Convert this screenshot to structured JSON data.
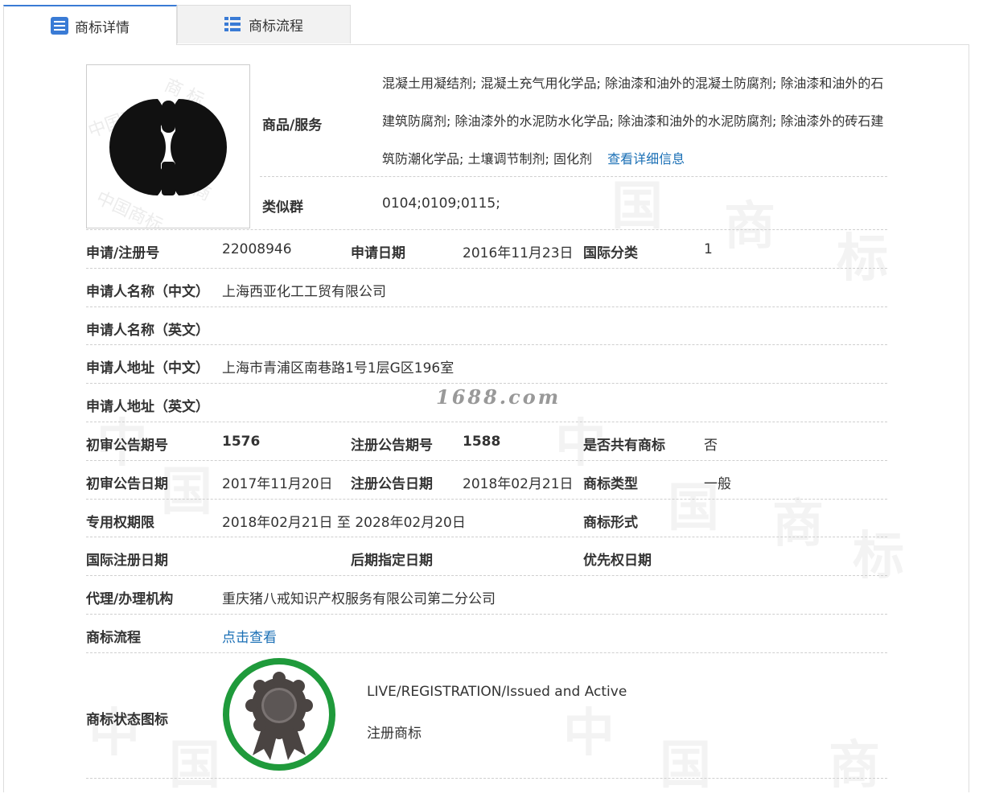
{
  "tabs": [
    {
      "label": "商标详情",
      "icon": "list-document-icon",
      "active": true
    },
    {
      "label": "商标流程",
      "icon": "grid-list-icon",
      "active": false
    }
  ],
  "watermark": {
    "center": "1688.com"
  },
  "goods": {
    "label": "商品/服务",
    "text": "混凝土用凝结剂; 混凝土充气用化学品; 除油漆和油外的混凝土防腐剂; 除油漆和油外的石建筑防腐剂; 除油漆外的水泥防水化学品; 除油漆和油外的水泥防腐剂; 除油漆外的砖石建筑防潮化学品; 土壤调节制剂; 固化剂",
    "more_link": "查看详细信息"
  },
  "similar_group": {
    "label": "类似群",
    "value": "0104;0109;0115;"
  },
  "fields": {
    "reg_no": {
      "label": "申请/注册号",
      "value": "22008946"
    },
    "apply_date": {
      "label": "申请日期",
      "value": "2016年11月23日"
    },
    "intl_class": {
      "label": "国际分类",
      "value": "1"
    },
    "applicant_cn": {
      "label": "申请人名称（中文）",
      "value": "上海西亚化工工贸有限公司"
    },
    "applicant_en": {
      "label": "申请人名称（英文）",
      "value": ""
    },
    "address_cn": {
      "label": "申请人地址（中文）",
      "value": "上海市青浦区南巷路1号1层G区196室"
    },
    "address_en": {
      "label": "申请人地址（英文）",
      "value": ""
    },
    "prelim_issue": {
      "label": "初审公告期号",
      "value": "1576"
    },
    "reg_issue": {
      "label": "注册公告期号",
      "value": "1588"
    },
    "shared": {
      "label": "是否共有商标",
      "value": "否"
    },
    "prelim_date": {
      "label": "初审公告日期",
      "value": "2017年11月20日"
    },
    "reg_date": {
      "label": "注册公告日期",
      "value": "2018年02月21日"
    },
    "tm_type": {
      "label": "商标类型",
      "value": "一般"
    },
    "exclusive_period": {
      "label": "专用权期限",
      "value": "2018年02月21日 至 2028年02月20日"
    },
    "tm_form": {
      "label": "商标形式",
      "value": ""
    },
    "intl_reg_date": {
      "label": "国际注册日期",
      "value": ""
    },
    "later_designation": {
      "label": "后期指定日期",
      "value": ""
    },
    "priority_date": {
      "label": "优先权日期",
      "value": ""
    },
    "agent": {
      "label": "代理/办理机构",
      "value": "重庆猪八戒知识产权服务有限公司第二分公司"
    },
    "process": {
      "label": "商标流程",
      "link": "点击查看"
    },
    "status": {
      "label": "商标状态图标",
      "en": "LIVE/REGISTRATION/Issued and Active",
      "cn": "注册商标"
    }
  },
  "colors": {
    "accent": "#3a7bd5",
    "link": "#1a6fb5",
    "badge_ring": "#1f9a3b",
    "badge_body": "#4a4442"
  }
}
